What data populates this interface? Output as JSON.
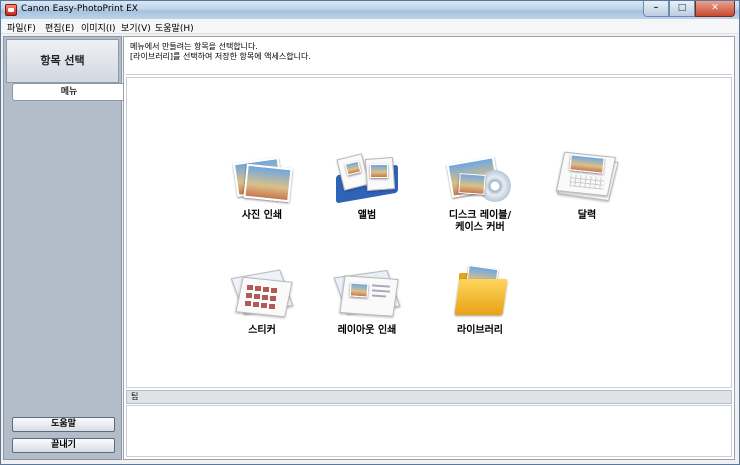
{
  "window": {
    "title": "Canon Easy-PhotoPrint EX",
    "buttons": [
      "–",
      "□",
      "✕"
    ]
  },
  "menu": [
    "파일(F)",
    "편집(E)",
    "이미지(I)",
    "보기(V)",
    "도움말(H)"
  ],
  "sidebar": {
    "header": "항목 선택",
    "tab": "메뉴",
    "help_button": "도움말",
    "exit_button": "끝내기"
  },
  "description": {
    "line1": "메뉴에서 만들려는 항목을 선택합니다.",
    "line2": "[라이브러리]를 선택하여 저장한 항목에 액세스합니다."
  },
  "items": [
    {
      "label": "사진 인쇄",
      "icon": "photo-print-icon"
    },
    {
      "label": "앨범",
      "icon": "album-icon"
    },
    {
      "label": "디스크 레이블/\n케이스 커버",
      "icon": "disc-label-icon"
    },
    {
      "label": "달력",
      "icon": "calendar-icon"
    },
    {
      "label": "스티커",
      "icon": "sticker-icon"
    },
    {
      "label": "레이아웃 인쇄",
      "icon": "layout-print-icon"
    },
    {
      "label": "라이브러리",
      "icon": "library-folder-icon"
    }
  ],
  "tip": {
    "label": "팁"
  }
}
